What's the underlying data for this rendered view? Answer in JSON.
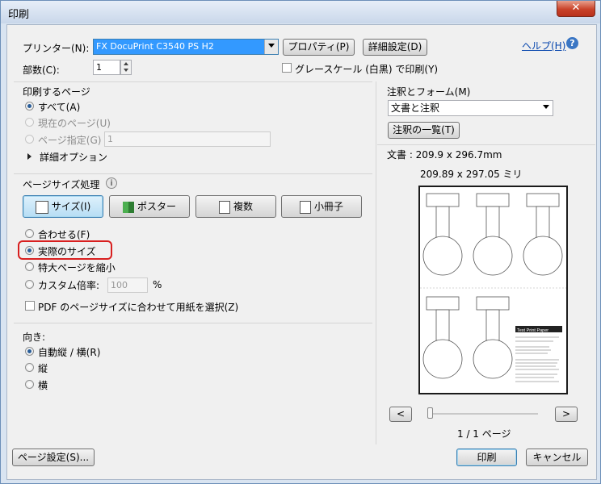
{
  "window": {
    "title": "印刷",
    "close": "✕"
  },
  "header": {
    "printer_label": "プリンター(N):",
    "printer_value": "FX DocuPrint C3540 PS H2",
    "properties_button": "プロパティ(P)",
    "advanced_button": "詳細設定(D)",
    "help_link": "ヘルプ(H)",
    "copies_label": "部数(C):",
    "copies_value": "1",
    "grayscale_label": "グレースケール (白黒) で印刷(Y)"
  },
  "pages_to_print": {
    "heading": "印刷するページ",
    "all": "すべて(A)",
    "current": "現在のページ(U)",
    "range": "ページ指定(G)",
    "range_value": "1",
    "more_options": "詳細オプション"
  },
  "page_sizing": {
    "heading": "ページサイズ処理",
    "tabs": [
      "サイズ(I)",
      "ポスター",
      "複数",
      "小冊子"
    ],
    "fit": "合わせる(F)",
    "actual_size": "実際のサイズ",
    "shrink": "特大ページを縮小",
    "custom_scale": "カスタム倍率:",
    "custom_value": "100",
    "percent": "%",
    "choose_paper": "PDF のページサイズに合わせて用紙を選択(Z)"
  },
  "orientation": {
    "heading": "向き:",
    "auto": "自動縦 / 横(R)",
    "portrait": "縦",
    "landscape": "横"
  },
  "comments_forms": {
    "heading": "注釈とフォーム(M)",
    "value": "文書と注釈",
    "summarize_button": "注釈の一覧(T)"
  },
  "preview": {
    "doc_size": "文書 : 209.9 x 296.7mm",
    "paper_size": "209.89 x 297.05 ミリ",
    "prev": "<",
    "next": ">",
    "page_count": "1 / 1 ページ",
    "thumb_title": "Test Print Paper"
  },
  "footer": {
    "page_setup": "ページ設定(S)...",
    "print": "印刷",
    "cancel": "キャンセル"
  }
}
